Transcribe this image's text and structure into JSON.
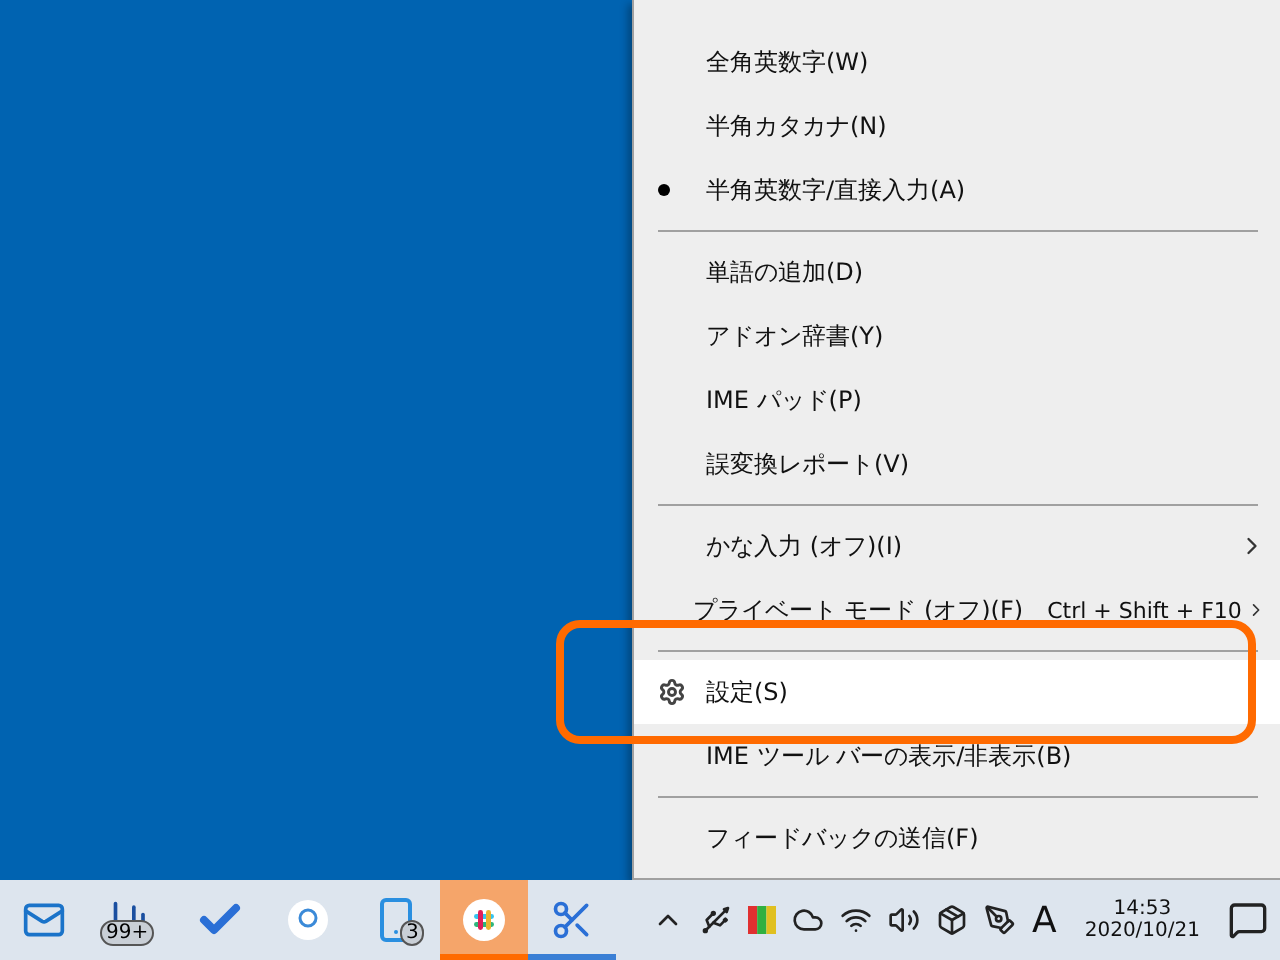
{
  "menu": {
    "items": [
      {
        "kind": "radio",
        "label": "全角英数字(W)",
        "checked": false,
        "selected": false
      },
      {
        "kind": "radio",
        "label": "半角カタカナ(N)",
        "checked": false,
        "selected": false
      },
      {
        "kind": "radio",
        "label": "半角英数字/直接入力(A)",
        "checked": true,
        "selected": false
      },
      {
        "kind": "separator"
      },
      {
        "kind": "command",
        "label": "単語の追加(D)",
        "selected": false
      },
      {
        "kind": "command",
        "label": "アドオン辞書(Y)",
        "selected": false
      },
      {
        "kind": "command",
        "label": "IME パッド(P)",
        "selected": false
      },
      {
        "kind": "command",
        "label": "誤変換レポート(V)",
        "selected": false
      },
      {
        "kind": "separator"
      },
      {
        "kind": "submenu",
        "label": "かな入力 (オフ)(I)",
        "selected": false
      },
      {
        "kind": "submenu",
        "label": "プライベート モード (オフ)(F)",
        "shortcut": "Ctrl + Shift + F10",
        "selected": false
      },
      {
        "kind": "separator"
      },
      {
        "kind": "settings",
        "label": "設定(S)",
        "selected": true
      },
      {
        "kind": "command",
        "label": "IME ツール バーの表示/非表示(B)",
        "selected": false
      },
      {
        "kind": "separator"
      },
      {
        "kind": "command",
        "label": "フィードバックの送信(F)",
        "selected": false
      }
    ]
  },
  "taskbar": {
    "apps": [
      {
        "selected": false,
        "running": false
      },
      {
        "selected": false,
        "running": false,
        "badge": "99+"
      },
      {
        "selected": false,
        "running": false
      },
      {
        "selected": false,
        "running": false
      },
      {
        "selected": false,
        "running": false,
        "badge": "3"
      },
      {
        "selected": true,
        "running": true
      },
      {
        "selected": false,
        "running": true
      }
    ],
    "ime_mode": "A",
    "time": "14:53",
    "date": "2020/10/21"
  }
}
